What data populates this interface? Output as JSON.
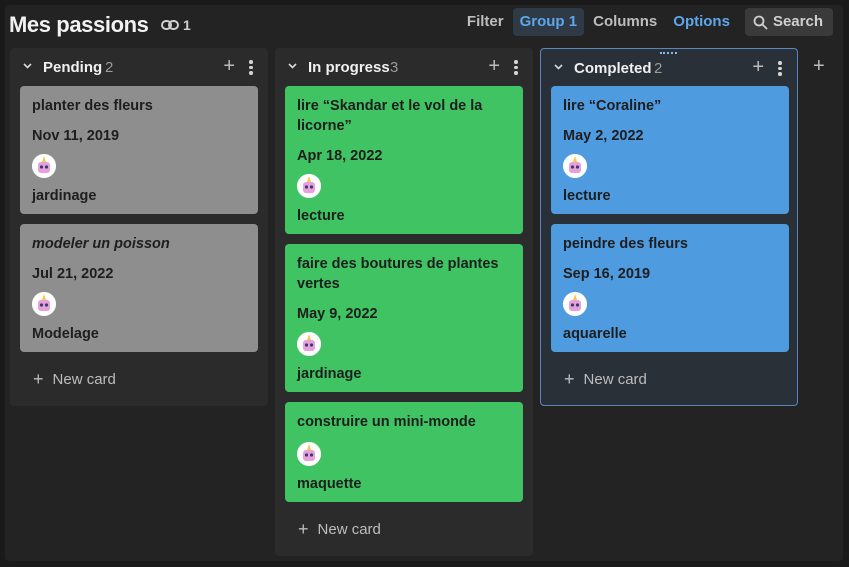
{
  "board": {
    "title": "Mes passions",
    "link_count": "1",
    "link_icon": "link-icon"
  },
  "toolbar": {
    "filter": "Filter",
    "group": "Group 1",
    "columns": "Columns",
    "options": "Options",
    "search": "Search"
  },
  "colors": {
    "gray": "#8e8e8e",
    "green": "#40c463",
    "blue": "#4f9be0",
    "accent": "#5ea6ea"
  },
  "columns": [
    {
      "title": "Pending",
      "count": "2",
      "new_card": "New card",
      "cards": [
        {
          "title": "planter des fleurs",
          "date": "Nov 11, 2019",
          "tag": "jardinage"
        },
        {
          "title": "modeler un poisson",
          "date": "Jul 21, 2022",
          "tag": "Modelage"
        }
      ]
    },
    {
      "title": "In progress",
      "count": "3",
      "new_card": "New card",
      "cards": [
        {
          "title": "lire “Skandar et le vol de la licorne”",
          "date": "Apr 18, 2022",
          "tag": "lecture"
        },
        {
          "title": "faire des boutures de plantes vertes",
          "date": "May 9, 2022",
          "tag": "jardinage"
        },
        {
          "title": "construire un mini-monde",
          "tag": "maquette"
        }
      ]
    },
    {
      "title": "Completed",
      "count": "2",
      "new_card": "New card",
      "cards": [
        {
          "title": "lire “Coraline”",
          "date": "May 2, 2022",
          "tag": "lecture"
        },
        {
          "title": "peindre des fleurs",
          "date": "Sep 16, 2019",
          "tag": "aquarelle"
        }
      ]
    }
  ]
}
